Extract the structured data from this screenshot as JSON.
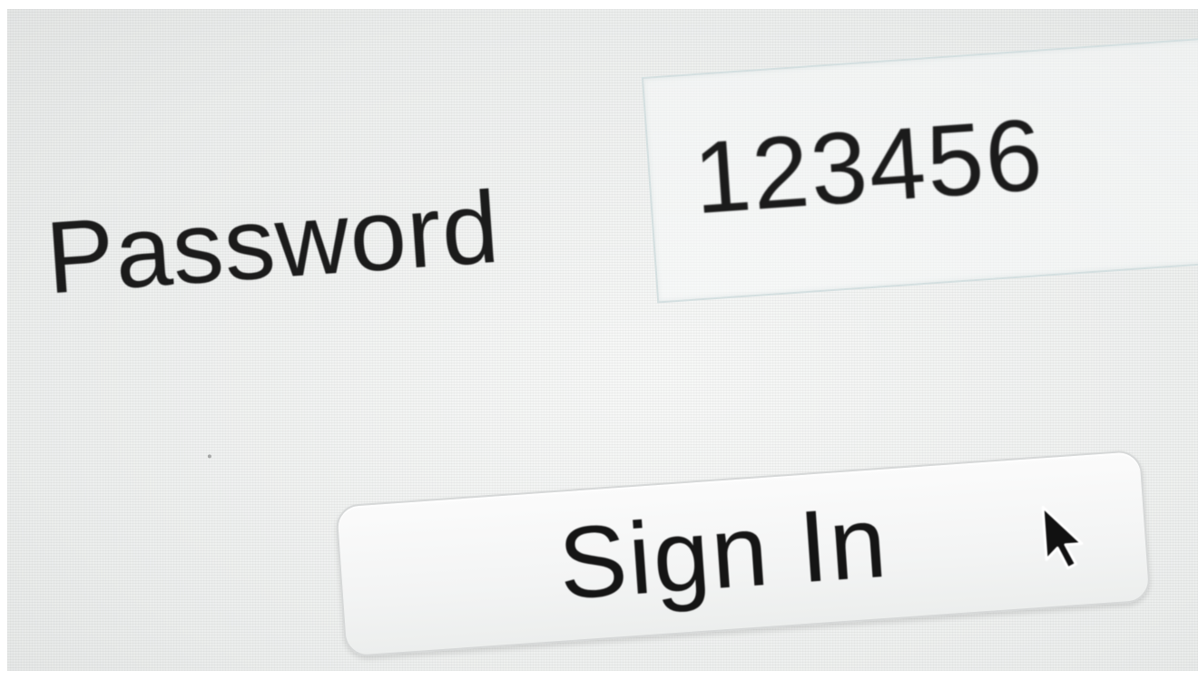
{
  "login_form": {
    "password_label": "Password",
    "password_value": "123456",
    "sign_in_label": "Sign In"
  },
  "icons": {
    "cursor": "mouse-pointer-arrow"
  },
  "colors": {
    "text": "#1b1b1b",
    "background": "#f1f2f1",
    "field_border": "#d4dfe0",
    "button_border": "#d6d8d8"
  }
}
